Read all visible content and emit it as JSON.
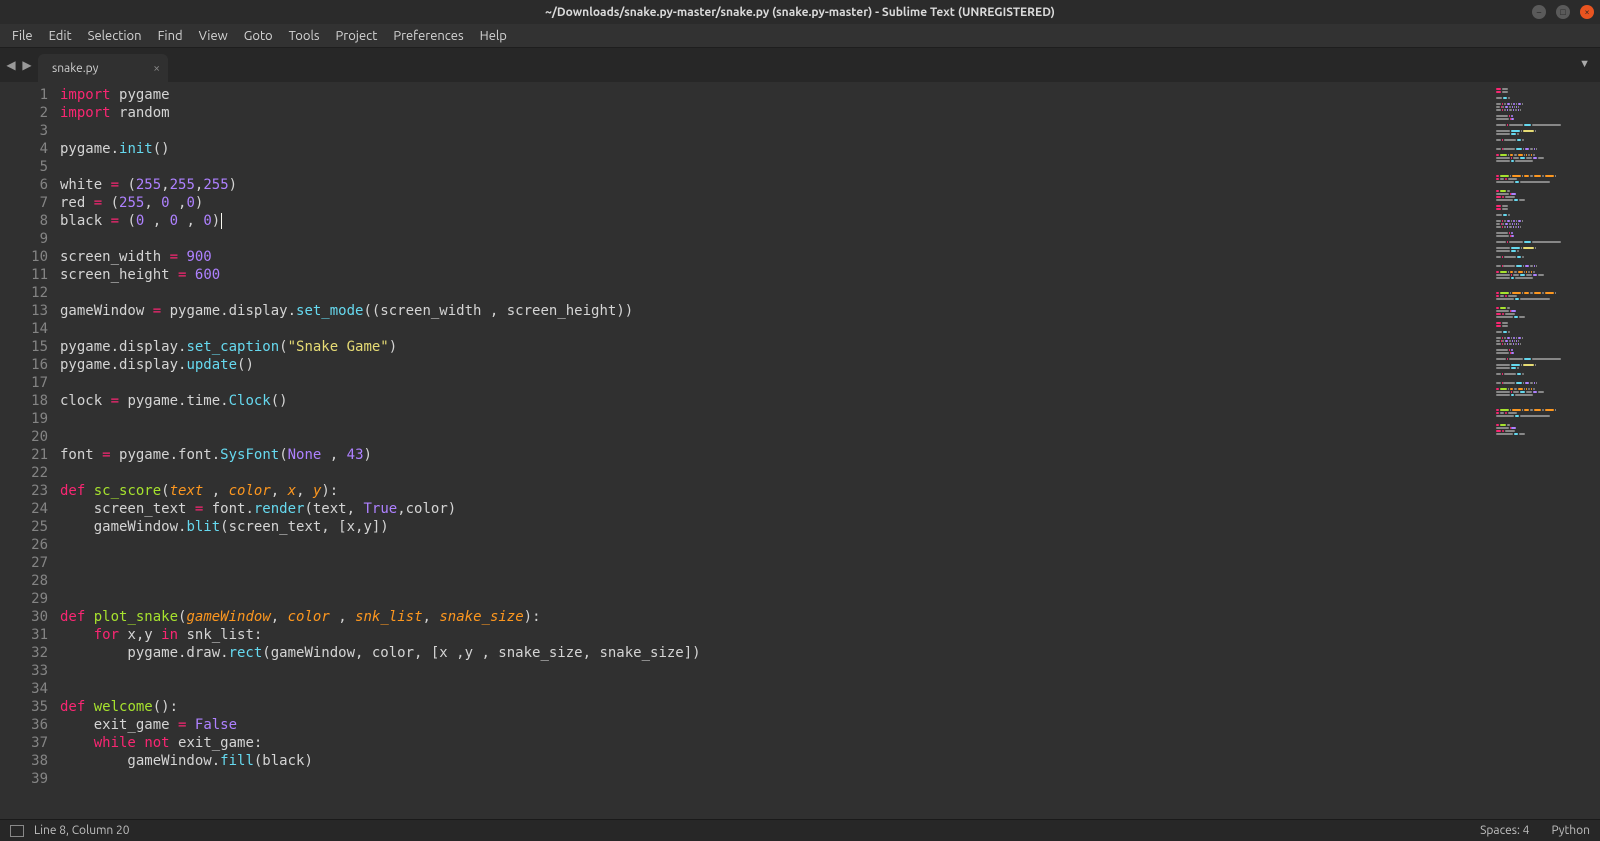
{
  "title": "~/Downloads/snake.py-master/snake.py (snake.py-master) - Sublime Text (UNREGISTERED)",
  "menu": [
    "File",
    "Edit",
    "Selection",
    "Find",
    "View",
    "Goto",
    "Tools",
    "Project",
    "Preferences",
    "Help"
  ],
  "tab": {
    "name": "snake.py"
  },
  "statusbar": {
    "position": "Line 8, Column 20",
    "spaces": "Spaces: 4",
    "syntax": "Python"
  },
  "cursor_line": 8,
  "code_lines": [
    {
      "n": 1,
      "tokens": [
        [
          "kw",
          "import"
        ],
        [
          "",
          " "
        ],
        [
          "",
          "pygame"
        ]
      ]
    },
    {
      "n": 2,
      "tokens": [
        [
          "kw",
          "import"
        ],
        [
          "",
          " "
        ],
        [
          "",
          "random"
        ]
      ]
    },
    {
      "n": 3,
      "tokens": []
    },
    {
      "n": 4,
      "tokens": [
        [
          "",
          "pygame."
        ],
        [
          "fn",
          "init"
        ],
        [
          "",
          "()"
        ]
      ]
    },
    {
      "n": 5,
      "tokens": []
    },
    {
      "n": 6,
      "tokens": [
        [
          "",
          "white "
        ],
        [
          "op",
          "="
        ],
        [
          "",
          " ("
        ],
        [
          "num",
          "255"
        ],
        [
          "",
          ","
        ],
        [
          "num",
          "255"
        ],
        [
          "",
          ","
        ],
        [
          "num",
          "255"
        ],
        [
          "",
          ")"
        ]
      ]
    },
    {
      "n": 7,
      "tokens": [
        [
          "",
          "red "
        ],
        [
          "op",
          "="
        ],
        [
          "",
          " ("
        ],
        [
          "num",
          "255"
        ],
        [
          "",
          ", "
        ],
        [
          "num",
          "0"
        ],
        [
          "",
          " ,"
        ],
        [
          "num",
          "0"
        ],
        [
          "",
          ")"
        ]
      ]
    },
    {
      "n": 8,
      "tokens": [
        [
          "",
          "black "
        ],
        [
          "op",
          "="
        ],
        [
          "",
          " ("
        ],
        [
          "num",
          "0"
        ],
        [
          "",
          " , "
        ],
        [
          "num",
          "0"
        ],
        [
          "",
          " , "
        ],
        [
          "num",
          "0"
        ],
        [
          "",
          ")"
        ]
      ]
    },
    {
      "n": 9,
      "tokens": []
    },
    {
      "n": 10,
      "tokens": [
        [
          "",
          "screen_width "
        ],
        [
          "op",
          "="
        ],
        [
          "",
          " "
        ],
        [
          "num",
          "900"
        ]
      ]
    },
    {
      "n": 11,
      "tokens": [
        [
          "",
          "screen_height "
        ],
        [
          "op",
          "="
        ],
        [
          "",
          " "
        ],
        [
          "num",
          "600"
        ]
      ]
    },
    {
      "n": 12,
      "tokens": []
    },
    {
      "n": 13,
      "tokens": [
        [
          "",
          "gameWindow "
        ],
        [
          "op",
          "="
        ],
        [
          "",
          " pygame.display."
        ],
        [
          "fn",
          "set_mode"
        ],
        [
          "",
          "((screen_width , screen_height))"
        ]
      ]
    },
    {
      "n": 14,
      "tokens": []
    },
    {
      "n": 15,
      "tokens": [
        [
          "",
          "pygame.display."
        ],
        [
          "fn",
          "set_caption"
        ],
        [
          "",
          "("
        ],
        [
          "str",
          "\"Snake Game\""
        ],
        [
          "",
          ")"
        ]
      ]
    },
    {
      "n": 16,
      "tokens": [
        [
          "",
          "pygame.display."
        ],
        [
          "fn",
          "update"
        ],
        [
          "",
          "()"
        ]
      ]
    },
    {
      "n": 17,
      "tokens": []
    },
    {
      "n": 18,
      "tokens": [
        [
          "",
          "clock "
        ],
        [
          "op",
          "="
        ],
        [
          "",
          " pygame.time."
        ],
        [
          "fn",
          "Clock"
        ],
        [
          "",
          "()"
        ]
      ]
    },
    {
      "n": 19,
      "tokens": []
    },
    {
      "n": 20,
      "tokens": []
    },
    {
      "n": 21,
      "tokens": [
        [
          "",
          "font "
        ],
        [
          "op",
          "="
        ],
        [
          "",
          " pygame.font."
        ],
        [
          "fn",
          "SysFont"
        ],
        [
          "",
          "("
        ],
        [
          "const",
          "None"
        ],
        [
          "",
          " , "
        ],
        [
          "num",
          "43"
        ],
        [
          "",
          ")"
        ]
      ]
    },
    {
      "n": 22,
      "tokens": []
    },
    {
      "n": 23,
      "tokens": [
        [
          "kw",
          "def"
        ],
        [
          "",
          " "
        ],
        [
          "def",
          "sc_score"
        ],
        [
          "",
          "("
        ],
        [
          "param",
          "text"
        ],
        [
          "",
          " , "
        ],
        [
          "param",
          "color"
        ],
        [
          "",
          ", "
        ],
        [
          "param",
          "x"
        ],
        [
          "",
          ", "
        ],
        [
          "param",
          "y"
        ],
        [
          "",
          "):"
        ]
      ]
    },
    {
      "n": 24,
      "tokens": [
        [
          "",
          "    screen_text "
        ],
        [
          "op",
          "="
        ],
        [
          "",
          " font."
        ],
        [
          "fn",
          "render"
        ],
        [
          "",
          "(text, "
        ],
        [
          "const",
          "True"
        ],
        [
          "",
          ",color)"
        ]
      ]
    },
    {
      "n": 25,
      "tokens": [
        [
          "",
          "    gameWindow."
        ],
        [
          "fn",
          "blit"
        ],
        [
          "",
          "(screen_text, [x,y])"
        ]
      ]
    },
    {
      "n": 26,
      "tokens": []
    },
    {
      "n": 27,
      "tokens": []
    },
    {
      "n": 28,
      "tokens": []
    },
    {
      "n": 29,
      "tokens": []
    },
    {
      "n": 30,
      "tokens": [
        [
          "kw",
          "def"
        ],
        [
          "",
          " "
        ],
        [
          "def",
          "plot_snake"
        ],
        [
          "",
          "("
        ],
        [
          "param",
          "gameWindow"
        ],
        [
          "",
          ", "
        ],
        [
          "param",
          "color"
        ],
        [
          "",
          " , "
        ],
        [
          "param",
          "snk_list"
        ],
        [
          "",
          ", "
        ],
        [
          "param",
          "snake_size"
        ],
        [
          "",
          "):"
        ]
      ]
    },
    {
      "n": 31,
      "tokens": [
        [
          "",
          "    "
        ],
        [
          "kw",
          "for"
        ],
        [
          "",
          " x,y "
        ],
        [
          "kw",
          "in"
        ],
        [
          "",
          " snk_list:"
        ]
      ]
    },
    {
      "n": 32,
      "tokens": [
        [
          "",
          "        pygame.draw."
        ],
        [
          "fn",
          "rect"
        ],
        [
          "",
          "(gameWindow, color, [x ,y , snake_size, snake_size])"
        ]
      ]
    },
    {
      "n": 33,
      "tokens": []
    },
    {
      "n": 34,
      "tokens": []
    },
    {
      "n": 35,
      "tokens": [
        [
          "kw",
          "def"
        ],
        [
          "",
          " "
        ],
        [
          "def",
          "welcome"
        ],
        [
          "",
          "():"
        ]
      ]
    },
    {
      "n": 36,
      "tokens": [
        [
          "",
          "    exit_game "
        ],
        [
          "op",
          "="
        ],
        [
          "",
          " "
        ],
        [
          "const",
          "False"
        ]
      ]
    },
    {
      "n": 37,
      "tokens": [
        [
          "",
          "    "
        ],
        [
          "kw",
          "while"
        ],
        [
          "",
          " "
        ],
        [
          "kw",
          "not"
        ],
        [
          "",
          " exit_game:"
        ]
      ]
    },
    {
      "n": 38,
      "tokens": [
        [
          "",
          "        gameWindow."
        ],
        [
          "fn",
          "fill"
        ],
        [
          "",
          "(black)"
        ]
      ]
    },
    {
      "n": 39,
      "tokens": []
    }
  ]
}
